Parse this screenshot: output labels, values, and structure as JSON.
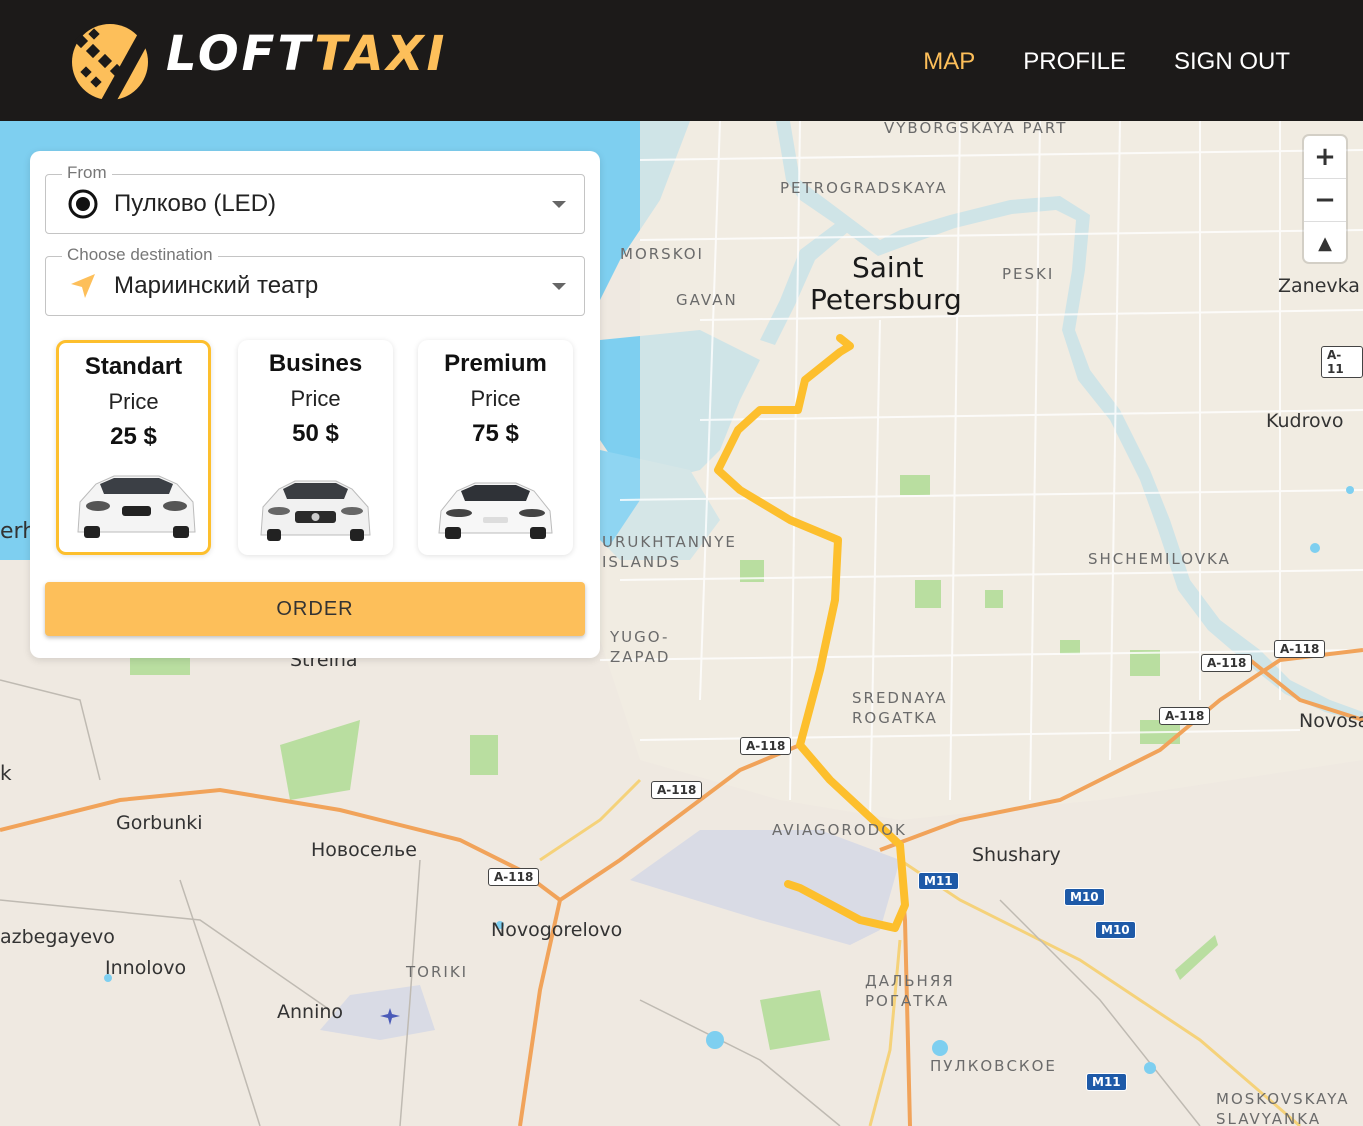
{
  "brand": {
    "part1": "LOFT",
    "part2": "TAXI",
    "accent_color": "#fdbf5a"
  },
  "nav": [
    {
      "label": "MAP",
      "active": true
    },
    {
      "label": "PROFILE",
      "active": false
    },
    {
      "label": "SIGN OUT",
      "active": false
    }
  ],
  "form": {
    "from": {
      "legend": "From",
      "value": "Пулково (LED)",
      "icon": "radio-origin-icon"
    },
    "to": {
      "legend": "Choose destination",
      "value": "Мариинский театр",
      "icon": "navigation-arrow-icon"
    },
    "tariffs": [
      {
        "name": "Standart",
        "price_label": "Price",
        "price": "25 $",
        "selected": true
      },
      {
        "name": "Busines",
        "price_label": "Price",
        "price": "50 $",
        "selected": false
      },
      {
        "name": "Premium",
        "price_label": "Price",
        "price": "75 $",
        "selected": false
      }
    ],
    "order_label": "ORDER"
  },
  "map": {
    "zoom_in": "+",
    "zoom_out": "−",
    "compass": "▲",
    "labels": {
      "vyborgskaya": "VYBORGSKAYA PART",
      "petrogradskaya": "PETROGRADSKAYA",
      "morskoi": "MORSKOI",
      "gavan": "GAVAN",
      "peski": "PESKI",
      "city_line1": "Saint",
      "city_line2": "Petersburg",
      "zanevka": "Zanevka",
      "kudrovo": "Kudrovo",
      "shchemilovka": "SHCHEMILOVKA",
      "urukhtannye": "URUKHTANNYE ISLANDS",
      "yugo_zapad": "YUGO- ZAPAD",
      "strelna": "Strelna",
      "srednaya": "SREDNAYA ROGATKA",
      "novosa": "Novosa",
      "gorbunki": "Gorbunki",
      "novoselye": "Новоселье",
      "aviagorodok": "AVIAGORODOK",
      "shushary": "Shushary",
      "novogorelovo": "Novogorelovo",
      "razbegayevo": "azbegayevo",
      "innolovo": "Innolovo",
      "toriki": "TORIKI",
      "annino": "Annino",
      "dalnyaya": "ДАЛЬНЯЯ РОГАТКА",
      "pulkovskoe": "ПУЛКОВСКОЕ",
      "moskovskaya": "MOSKOVSKAYA SLAVYANKA",
      "erh": "erh",
      "k": "k"
    },
    "shields": {
      "a118_1": "A-118",
      "a118_2": "A-118",
      "a118_3": "A-118",
      "a118_4": "A-118",
      "a118_5": "A-118",
      "a118_6": "A-118",
      "a11_edge": "A-11",
      "m11_1": "M11",
      "m11_2": "M11",
      "m10_1": "M10",
      "m10_2": "M10"
    },
    "colors": {
      "route": "#fdbf2d",
      "water": "#7ecff0",
      "land": "#efe9e1",
      "park": "#b9dea0",
      "highway": "#f1a35a"
    }
  }
}
